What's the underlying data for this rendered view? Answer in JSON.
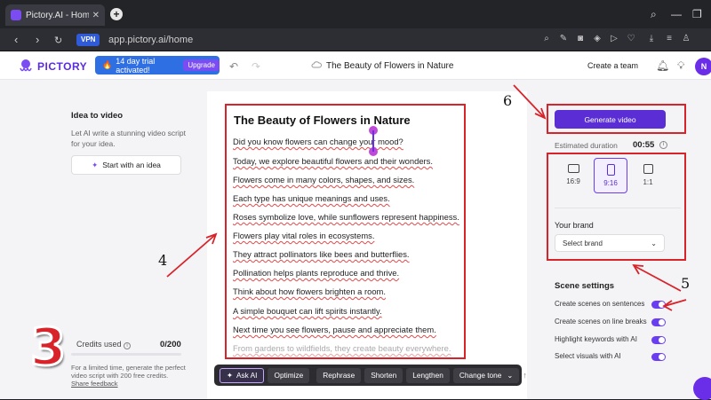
{
  "browser": {
    "tab_title": "Pictory.AI - Home of AI Vi",
    "url": "app.pictory.ai/home",
    "vpn_label": "VPN"
  },
  "header": {
    "logo": "PICTORY",
    "trial_text": "14 day trial activated!",
    "upgrade_label": "Upgrade",
    "doc_title": "The Beauty of Flowers in Nature",
    "create_team": "Create a team",
    "avatar": "N"
  },
  "left_panel": {
    "idea_title": "Idea to video",
    "idea_desc": "Let AI write a stunning video script for your idea.",
    "start_button": "Start with an idea",
    "credits_label": "Credits used",
    "credits_value": "0/200",
    "credits_fraction": 0,
    "credits_desc": "For a limited time, generate the perfect video script with 200 free credits.",
    "feedback": "Share feedback"
  },
  "script": {
    "title": "The Beauty of Flowers in Nature",
    "lines": [
      "Did you know flowers can change your mood?",
      "Today, we explore beautiful flowers and their wonders.",
      "Flowers come in many colors, shapes, and sizes.",
      "Each type has unique meanings and uses.",
      "Roses symbolize love, while sunflowers represent happiness.",
      "Flowers play vital roles in ecosystems.",
      "They attract pollinators like bees and butterflies.",
      "Pollination helps plants reproduce and thrive.",
      "Think about how flowers brighten a room.",
      "A simple bouquet can lift spirits instantly.",
      "Next time you see flowers, pause and appreciate them.",
      "From gardens to wildfields, they create beauty everywhere."
    ]
  },
  "toolbar": {
    "ask_ai": "Ask AI",
    "optimize": "Optimize",
    "rephrase": "Rephrase",
    "shorten": "Shorten",
    "lengthen": "Lengthen",
    "change_tone": "Change tone"
  },
  "right_panel": {
    "generate": "Generate video",
    "est_label": "Estimated duration",
    "est_value": "00:55",
    "ratios": [
      "16:9",
      "9:16",
      "1:1"
    ],
    "selected_ratio": "9:16",
    "brand_label": "Your brand",
    "brand_select": "Select brand",
    "scene_title": "Scene settings",
    "scene_options": [
      "Create scenes on sentences",
      "Create scenes on line breaks",
      "Highlight keywords with AI",
      "Select visuals with AI"
    ]
  },
  "annotations": {
    "n3": "3",
    "n4": "4",
    "n5": "5",
    "n6": "6"
  },
  "colors": {
    "brand": "#5a2ed4",
    "annotation": "#d8232a",
    "trial": "#2f6fe4"
  }
}
